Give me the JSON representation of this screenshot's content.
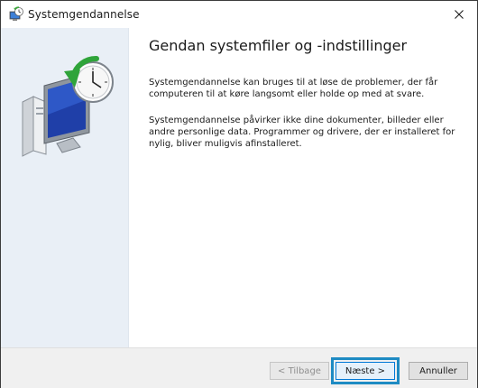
{
  "window": {
    "title": "Systemgendannelse",
    "app_icon": "system-restore-icon",
    "close_icon": "close-icon"
  },
  "main": {
    "heading": "Gendan systemfiler og -indstillinger",
    "paragraphs": [
      "Systemgendannelse kan bruges til at løse de problemer, der får computeren til at køre langsomt eller holde op med at svare.",
      "Systemgendannelse påvirker ikke dine dokumenter, billeder eller andre personlige data. Programmer og drivere, der er installeret for nylig, bliver muligvis afinstalleret."
    ],
    "hero_icon": "system-restore-computer-clock-icon"
  },
  "footer": {
    "back_label": "< Tilbage",
    "next_label": "Næste >",
    "cancel_label": "Annuller"
  },
  "colors": {
    "highlight_border": "#1e8bc3",
    "left_pane": "#e9eff6",
    "footer_bg": "#f0f0f0"
  }
}
